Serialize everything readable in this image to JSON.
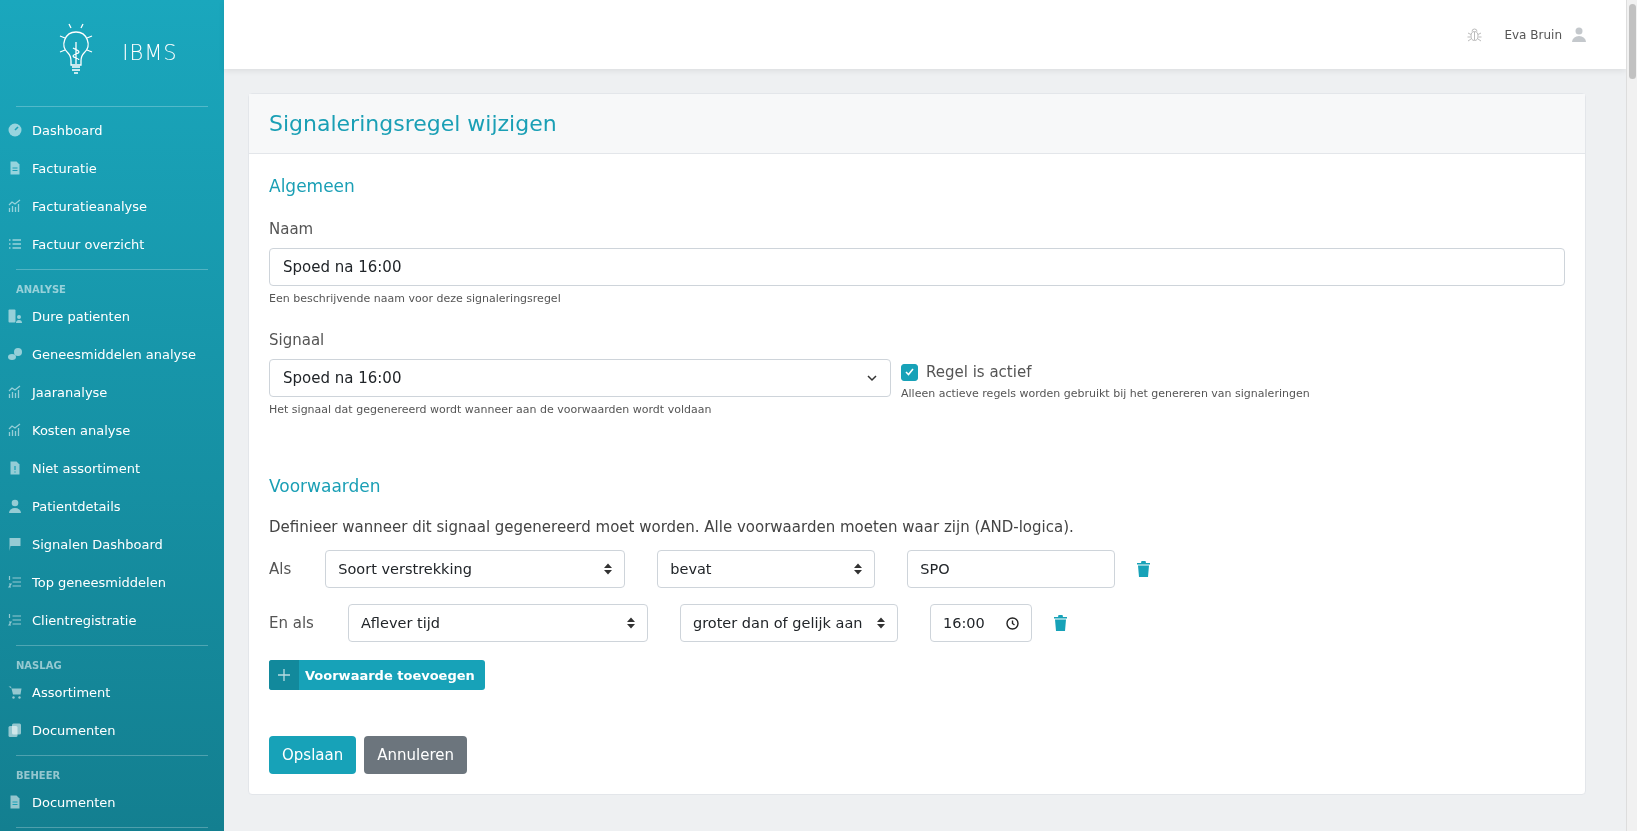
{
  "brand": {
    "name": "IBMS"
  },
  "sidebar": {
    "sections": [
      {
        "items": [
          {
            "label": "Dashboard",
            "kind": "gauge"
          },
          {
            "label": "Facturatie",
            "kind": "file"
          },
          {
            "label": "Facturatieanalyse",
            "kind": "chart"
          },
          {
            "label": "Factuur overzicht",
            "kind": "list"
          }
        ]
      },
      {
        "heading": "ANALYSE",
        "items": [
          {
            "label": "Dure patienten",
            "kind": "patients"
          },
          {
            "label": "Geneesmiddelen analyse",
            "kind": "pills"
          },
          {
            "label": "Jaaranalyse",
            "kind": "chart"
          },
          {
            "label": "Kosten analyse",
            "kind": "chart"
          },
          {
            "label": "Niet assortiment",
            "kind": "file-alert"
          },
          {
            "label": "Patientdetails",
            "kind": "user"
          },
          {
            "label": "Signalen Dashboard",
            "kind": "flag"
          },
          {
            "label": "Top geneesmiddelen",
            "kind": "ordered-list"
          },
          {
            "label": "Clientregistratie",
            "kind": "ordered-list"
          }
        ]
      },
      {
        "heading": "NASLAG",
        "items": [
          {
            "label": "Assortiment",
            "kind": "cart"
          },
          {
            "label": "Documenten",
            "kind": "copy"
          }
        ]
      },
      {
        "heading": "BEHEER",
        "items": [
          {
            "label": "Documenten",
            "kind": "file"
          }
        ]
      }
    ]
  },
  "header": {
    "user_name": "Eva Bruin"
  },
  "card": {
    "title": "Signaleringsregel wijzigen",
    "general": {
      "heading": "Algemeen",
      "name": {
        "label": "Naam",
        "value": "Spoed na 16:00",
        "help": "Een beschrijvende naam voor deze signaleringsregel"
      },
      "signal": {
        "label": "Signaal",
        "value": "Spoed na 16:00",
        "help": "Het signaal dat gegenereerd wordt wanneer aan de voorwaarden wordt voldaan"
      },
      "active": {
        "label": "Regel is actief",
        "checked": true,
        "help": "Alleen actieve regels worden gebruikt bij het genereren van signaleringen"
      }
    },
    "conditions": {
      "heading": "Voorwaarden",
      "description": "Definieer wanneer dit signaal gegenereerd moet worden. Alle voorwaarden moeten waar zijn (AND-logica).",
      "rows": [
        {
          "prefix": "Als",
          "field": "Soort verstrekking",
          "operator": "bevat",
          "kind": "text",
          "value": "SPO"
        },
        {
          "prefix": "En als",
          "field": "Aflever tijd",
          "operator": "groter dan of gelijk aan",
          "kind": "time",
          "value": "16:00"
        }
      ],
      "add_button": "Voorwaarde toevoegen"
    },
    "buttons": {
      "save": "Opslaan",
      "cancel": "Annuleren"
    }
  }
}
